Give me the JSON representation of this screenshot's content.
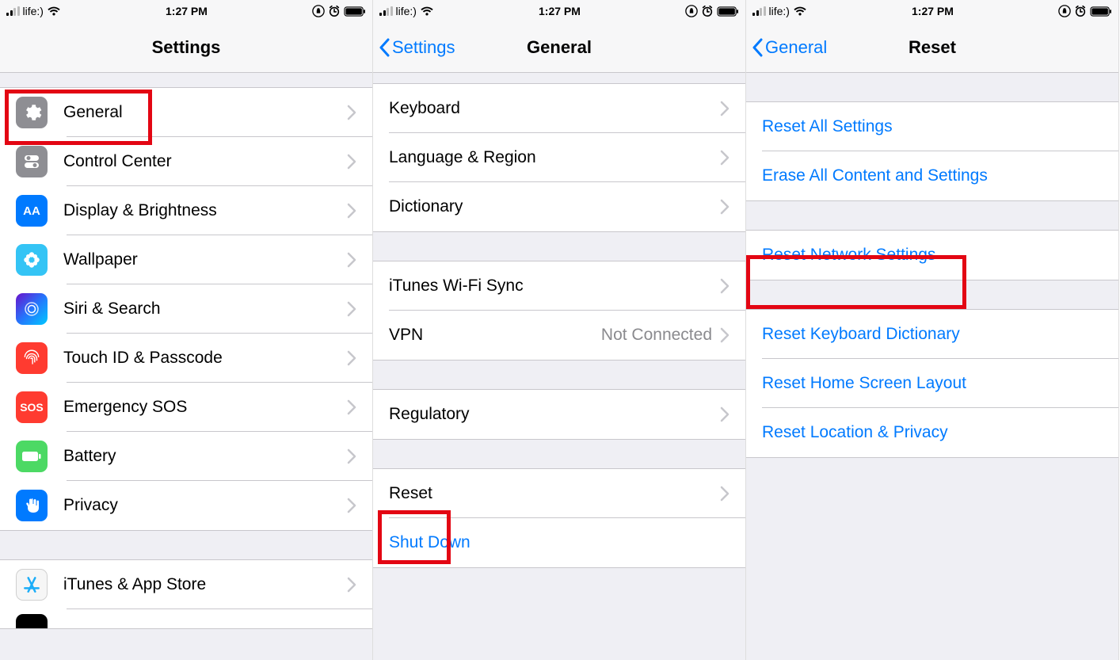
{
  "status": {
    "carrier": "life:)",
    "time": "1:27 PM"
  },
  "screen1": {
    "title": "Settings",
    "items": {
      "general": "General",
      "control_center": "Control Center",
      "display": "Display & Brightness",
      "wallpaper": "Wallpaper",
      "siri": "Siri & Search",
      "touchid": "Touch ID & Passcode",
      "sos": "Emergency SOS",
      "battery": "Battery",
      "privacy": "Privacy",
      "itunes": "iTunes & App Store"
    },
    "sos_label": "SOS",
    "brightness_label": "AA"
  },
  "screen2": {
    "back": "Settings",
    "title": "General",
    "items": {
      "keyboard": "Keyboard",
      "language": "Language & Region",
      "dictionary": "Dictionary",
      "itunes_wifi": "iTunes Wi-Fi Sync",
      "vpn": "VPN",
      "vpn_status": "Not Connected",
      "regulatory": "Regulatory",
      "reset": "Reset",
      "shutdown": "Shut Down"
    }
  },
  "screen3": {
    "back": "General",
    "title": "Reset",
    "items": {
      "reset_all": "Reset All Settings",
      "erase_all": "Erase All Content and Settings",
      "reset_network": "Reset Network Settings",
      "reset_keyboard": "Reset Keyboard Dictionary",
      "reset_home": "Reset Home Screen Layout",
      "reset_location": "Reset Location & Privacy"
    }
  }
}
